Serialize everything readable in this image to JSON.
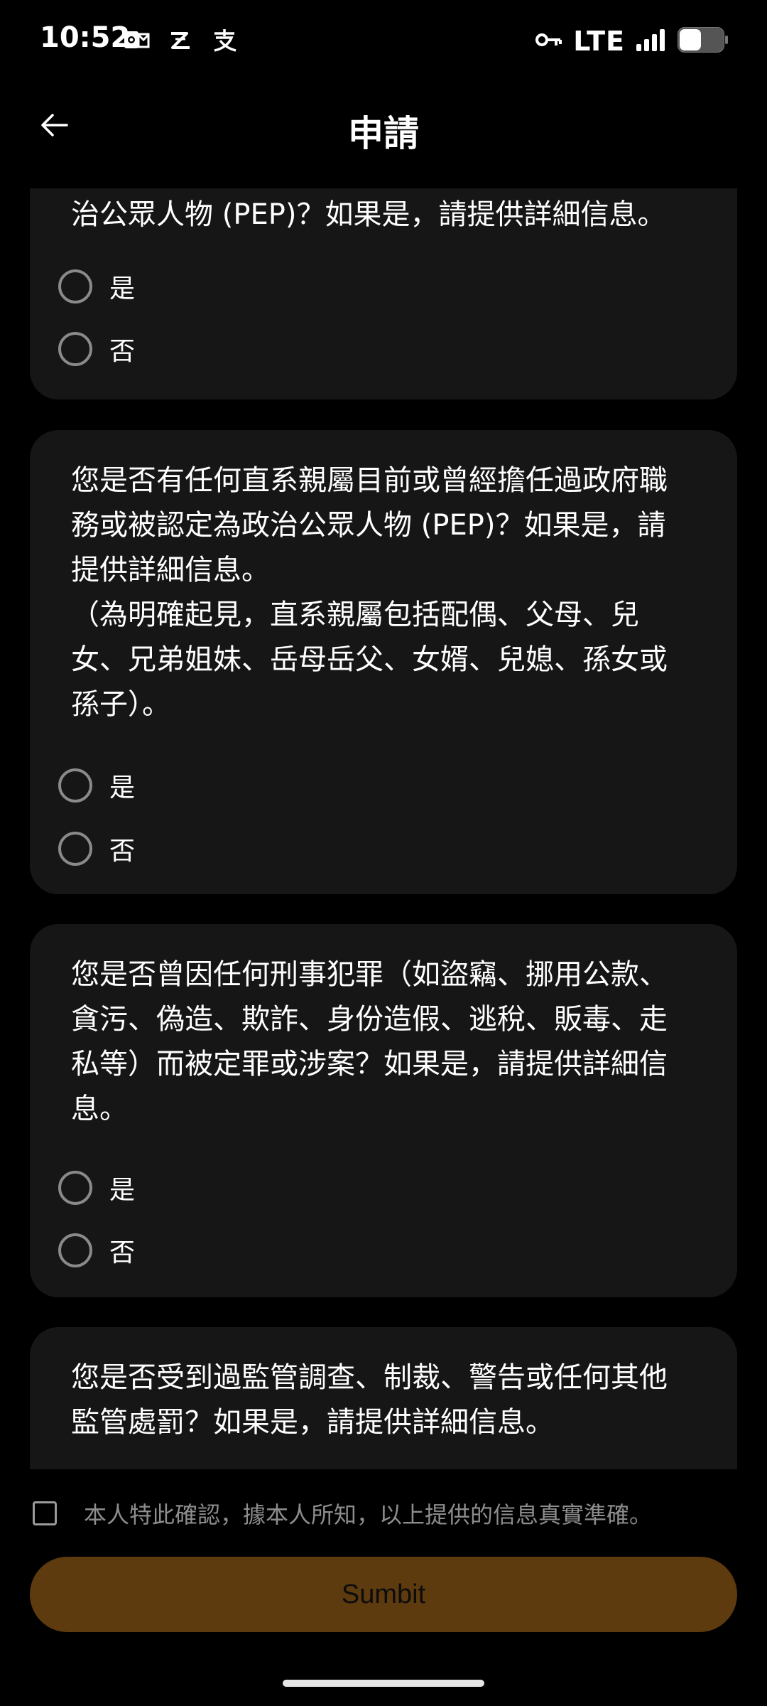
{
  "status_bar": {
    "time": "10:52",
    "network": "LTE",
    "notification_icons": [
      "outlook-icon",
      "zhihu-icon",
      "alipay-icon"
    ],
    "right_icons": [
      "vpn-key-icon",
      "signal-icon",
      "battery-icon"
    ]
  },
  "header": {
    "title": "申請",
    "back_icon": "arrow-left-icon"
  },
  "questions": [
    {
      "text": "治公眾人物 (PEP)？如果是，請提供詳細信息。",
      "options": [
        "是",
        "否"
      ]
    },
    {
      "text": "您是否有任何直系親屬目前或曾經擔任過政府職\n務或被認定為政治公眾人物 (PEP)？如果是，請\n提供詳細信息。\n（為明確起見，直系親屬包括配偶、父母、兒\n女、兄弟姐妹、岳母岳父、女婿、兒媳、孫女或\n孫子）。",
      "options": [
        "是",
        "否"
      ]
    },
    {
      "text": "您是否曾因任何刑事犯罪（如盜竊、挪用公款、\n貪污、偽造、欺詐、身份造假、逃稅、販毒、走\n私等）而被定罪或涉案？如果是，請提供詳細信\n息。",
      "options": [
        "是",
        "否"
      ]
    },
    {
      "text": "您是否受到過監管調查、制裁、警告或任何其他\n監管處罰？如果是，請提供詳細信息。",
      "options": []
    }
  ],
  "confirm": {
    "text": "本人特此確認，據本人所知，以上提供的信息真實準確。",
    "checked": false
  },
  "submit": {
    "label": "Sumbit"
  },
  "colors": {
    "background": "#000000",
    "card": "#161616",
    "submit_button": "#5e3b0f"
  }
}
